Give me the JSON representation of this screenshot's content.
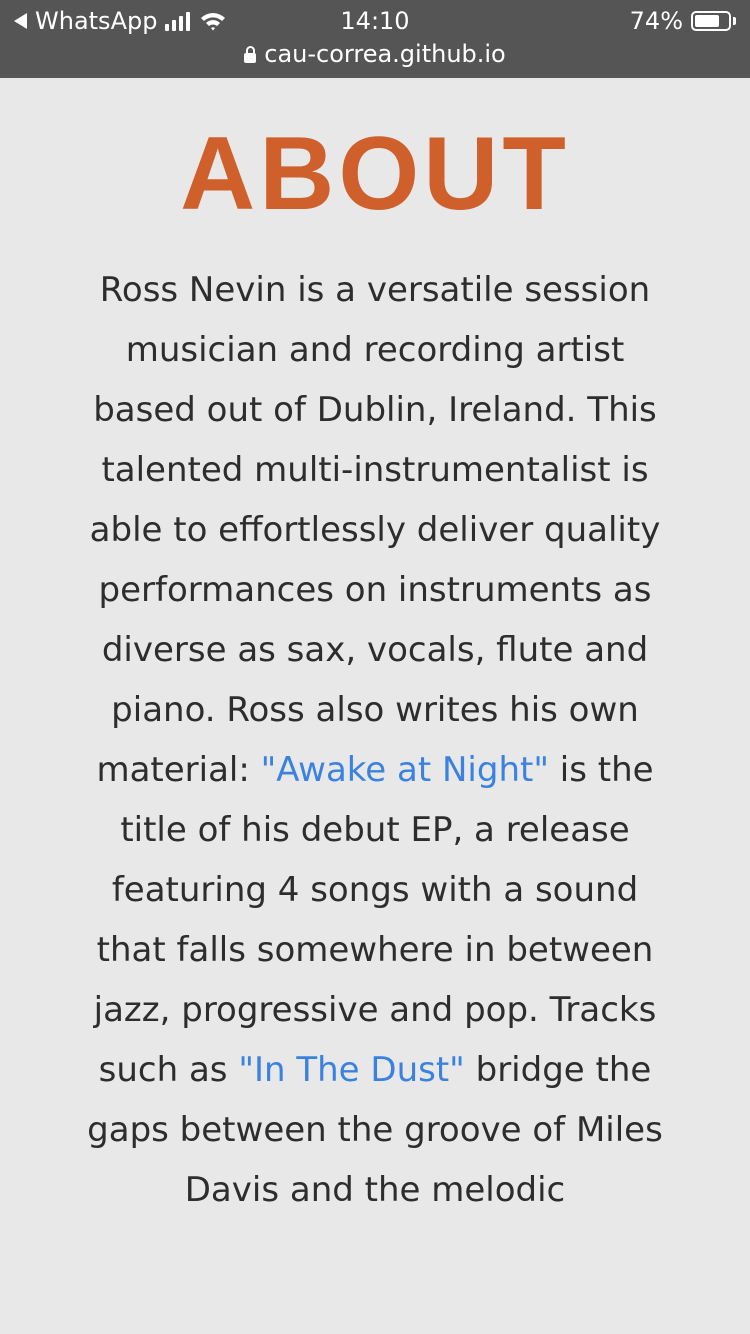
{
  "status_bar": {
    "back_app": "WhatsApp",
    "time": "14:10",
    "battery_percent": "74%",
    "battery_level": 0.74
  },
  "browser": {
    "url": "cau-correa.github.io"
  },
  "about": {
    "title": "ABOUT",
    "p1": "Ross Nevin is a versatile session musician and recording artist based out of Dublin, Ireland. This talented multi-instrumentalist is able to effortlessly deliver quality performances on instruments as diverse as sax, vocals, flute and piano. Ross also writes his own material: ",
    "link1": "\"Awake at Night\"",
    "p2": " is the title of his debut EP, a release featuring 4 songs with a sound that falls somewhere in between jazz, progressive and pop. Tracks such as ",
    "link2": "\"In The Dust\"",
    "p3": " bridge the gaps between the groove of Miles Davis and the melodic"
  },
  "colors": {
    "title": "#d0602b",
    "link": "#3b82e0",
    "background": "#e8e8e8",
    "status_bar": "#555555"
  }
}
